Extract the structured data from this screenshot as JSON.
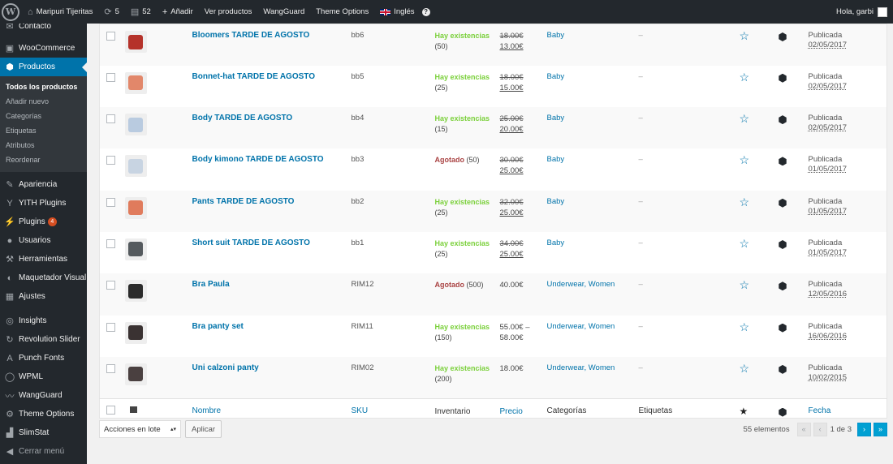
{
  "adminbar": {
    "site_name": "Maripuri Tijeritas",
    "updates_count": "5",
    "comments_count": "52",
    "add_new": "Añadir",
    "view_products": "Ver productos",
    "wangguard": "WangGuard",
    "theme_options": "Theme Options",
    "language": "Inglés",
    "help": "?",
    "greeting": "Hola, garbi"
  },
  "sidebar": {
    "items_top": [
      {
        "label": "Contacto",
        "icon": "mail-icon"
      },
      {
        "label": "WooCommerce",
        "icon": "woocommerce-icon"
      },
      {
        "label": "Productos",
        "icon": "products-icon"
      }
    ],
    "submenu": [
      "Todos los productos",
      "Añadir nuevo",
      "Categorías",
      "Etiquetas",
      "Atributos",
      "Reordenar"
    ],
    "items_bottom": [
      {
        "label": "Apariencia",
        "icon": "brush-icon"
      },
      {
        "label": "YITH Plugins",
        "icon": "yith-icon"
      },
      {
        "label": "Plugins",
        "icon": "plugins-icon",
        "badge": "4"
      },
      {
        "label": "Usuarios",
        "icon": "users-icon"
      },
      {
        "label": "Herramientas",
        "icon": "wrench-icon"
      },
      {
        "label": "Maquetador Visual",
        "icon": "visual-icon"
      },
      {
        "label": "Ajustes",
        "icon": "settings-icon"
      },
      {
        "label": "Insights",
        "icon": "insights-icon"
      },
      {
        "label": "Revolution Slider",
        "icon": "refresh-icon"
      },
      {
        "label": "Punch Fonts",
        "icon": "fonts-icon"
      },
      {
        "label": "WPML",
        "icon": "wpml-icon"
      },
      {
        "label": "WangGuard",
        "icon": "wave-icon"
      },
      {
        "label": "Theme Options",
        "icon": "gear-icon"
      },
      {
        "label": "SlimStat",
        "icon": "chart-icon"
      },
      {
        "label": "Cerrar menú",
        "icon": "collapse-icon"
      }
    ]
  },
  "products": [
    {
      "name": "Bloomers TARDE DE AGOSTO",
      "sku": "bb6",
      "stock": "Hay existencias",
      "qty": "(50)",
      "in_stock": true,
      "price_old": "18.00€",
      "price_new": "13.00€",
      "categories": [
        "Baby"
      ],
      "tags": "–",
      "status": "Publicada",
      "date": "02/05/2017",
      "thumb_color": "#b5322a"
    },
    {
      "name": "Bonnet-hat TARDE DE AGOSTO",
      "sku": "bb5",
      "stock": "Hay existencias",
      "qty": "(25)",
      "in_stock": true,
      "price_old": "18.00€",
      "price_new": "15.00€",
      "categories": [
        "Baby"
      ],
      "tags": "–",
      "status": "Publicada",
      "date": "02/05/2017",
      "thumb_color": "#e2876a"
    },
    {
      "name": "Body TARDE DE AGOSTO",
      "sku": "bb4",
      "stock": "Hay existencias",
      "qty": "(15)",
      "in_stock": true,
      "price_old": "25.00€",
      "price_new": "20.00€",
      "categories": [
        "Baby"
      ],
      "tags": "–",
      "status": "Publicada",
      "date": "02/05/2017",
      "thumb_color": "#b9cbe0"
    },
    {
      "name": "Body kimono TARDE DE AGOSTO",
      "sku": "bb3",
      "stock": "Agotado",
      "qty": "(50)",
      "in_stock": false,
      "price_old": "30.00€",
      "price_new": "25.00€",
      "categories": [
        "Baby"
      ],
      "tags": "–",
      "status": "Publicada",
      "date": "01/05/2017",
      "thumb_color": "#c8d4e2"
    },
    {
      "name": "Pants TARDE DE AGOSTO",
      "sku": "bb2",
      "stock": "Hay existencias",
      "qty": "(25)",
      "in_stock": true,
      "price_old": "32.00€",
      "price_new": "25.00€",
      "categories": [
        "Baby"
      ],
      "tags": "–",
      "status": "Publicada",
      "date": "01/05/2017",
      "thumb_color": "#e07b5c"
    },
    {
      "name": "Short suit TARDE DE AGOSTO",
      "sku": "bb1",
      "stock": "Hay existencias",
      "qty": "(25)",
      "in_stock": true,
      "price_old": "34.00€",
      "price_new": "25.00€",
      "categories": [
        "Baby"
      ],
      "tags": "–",
      "status": "Publicada",
      "date": "01/05/2017",
      "thumb_color": "#555a5e"
    },
    {
      "name": "Bra Paula",
      "sku": "RIM12",
      "stock": "Agotado",
      "qty": "(500)",
      "in_stock": false,
      "price_single": "40.00€",
      "categories": [
        "Underwear",
        "Women"
      ],
      "tags": "–",
      "status": "Publicada",
      "date": "12/05/2016",
      "thumb_color": "#2b2b2b"
    },
    {
      "name": "Bra panty set",
      "sku": "RIM11",
      "stock": "Hay existencias",
      "qty": "(150)",
      "in_stock": true,
      "price_range": "55.00€ –",
      "price_range_end": "58.00€",
      "categories": [
        "Underwear",
        "Women"
      ],
      "tags": "–",
      "status": "Publicada",
      "date": "16/06/2016",
      "thumb_color": "#3a3232"
    },
    {
      "name": "Uni calzoni panty",
      "sku": "RIM02",
      "stock": "Hay existencias",
      "qty": "(200)",
      "in_stock": true,
      "price_single": "18.00€",
      "categories": [
        "Underwear",
        "Women"
      ],
      "tags": "–",
      "status": "Publicada",
      "date": "10/02/2015",
      "thumb_color": "#4a4040"
    }
  ],
  "columns": {
    "name": "Nombre",
    "sku": "SKU",
    "stock": "Inventario",
    "price": "Precio",
    "categories": "Categorías",
    "tags": "Etiquetas",
    "date": "Fecha"
  },
  "bulk": {
    "select_label": "Acciones en lote",
    "apply": "Aplicar"
  },
  "pagination": {
    "count": "55 elementos",
    "first": "«",
    "prev": "‹",
    "current": "1 de 3",
    "next": "›",
    "last": "»"
  },
  "colors": {
    "accent": "#0073aa",
    "adminbar": "#23282d",
    "instock": "#7ad03a",
    "outstock": "#a44"
  }
}
